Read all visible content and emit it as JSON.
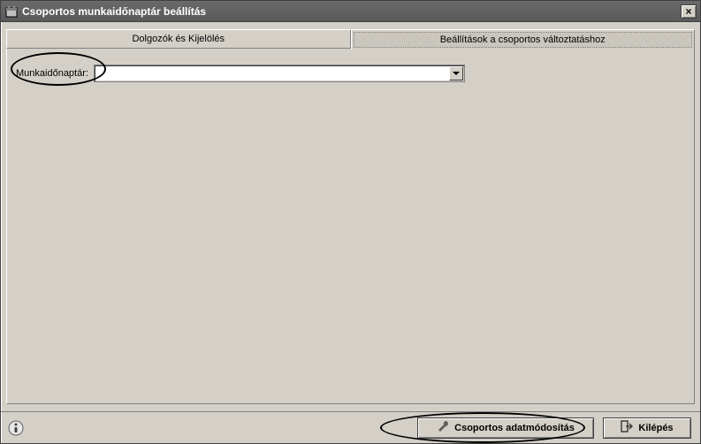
{
  "window": {
    "title": "Csoportos munkaidőnaptár beállítás"
  },
  "tabs": [
    {
      "label": "Dolgozók és Kijelölés",
      "active": false
    },
    {
      "label": "Beállítások a csoportos változtatáshoz",
      "active": true
    }
  ],
  "form": {
    "calendar_label": "Munkaidőnaptár:",
    "calendar_value": ""
  },
  "buttons": {
    "modify_label": "Csoportos adatmódosítás",
    "exit_label": "Kilépés"
  },
  "icons": {
    "app": "app-icon",
    "close": "×",
    "wrench": "wrench-icon",
    "exit": "exit-icon",
    "info": "info-icon"
  }
}
